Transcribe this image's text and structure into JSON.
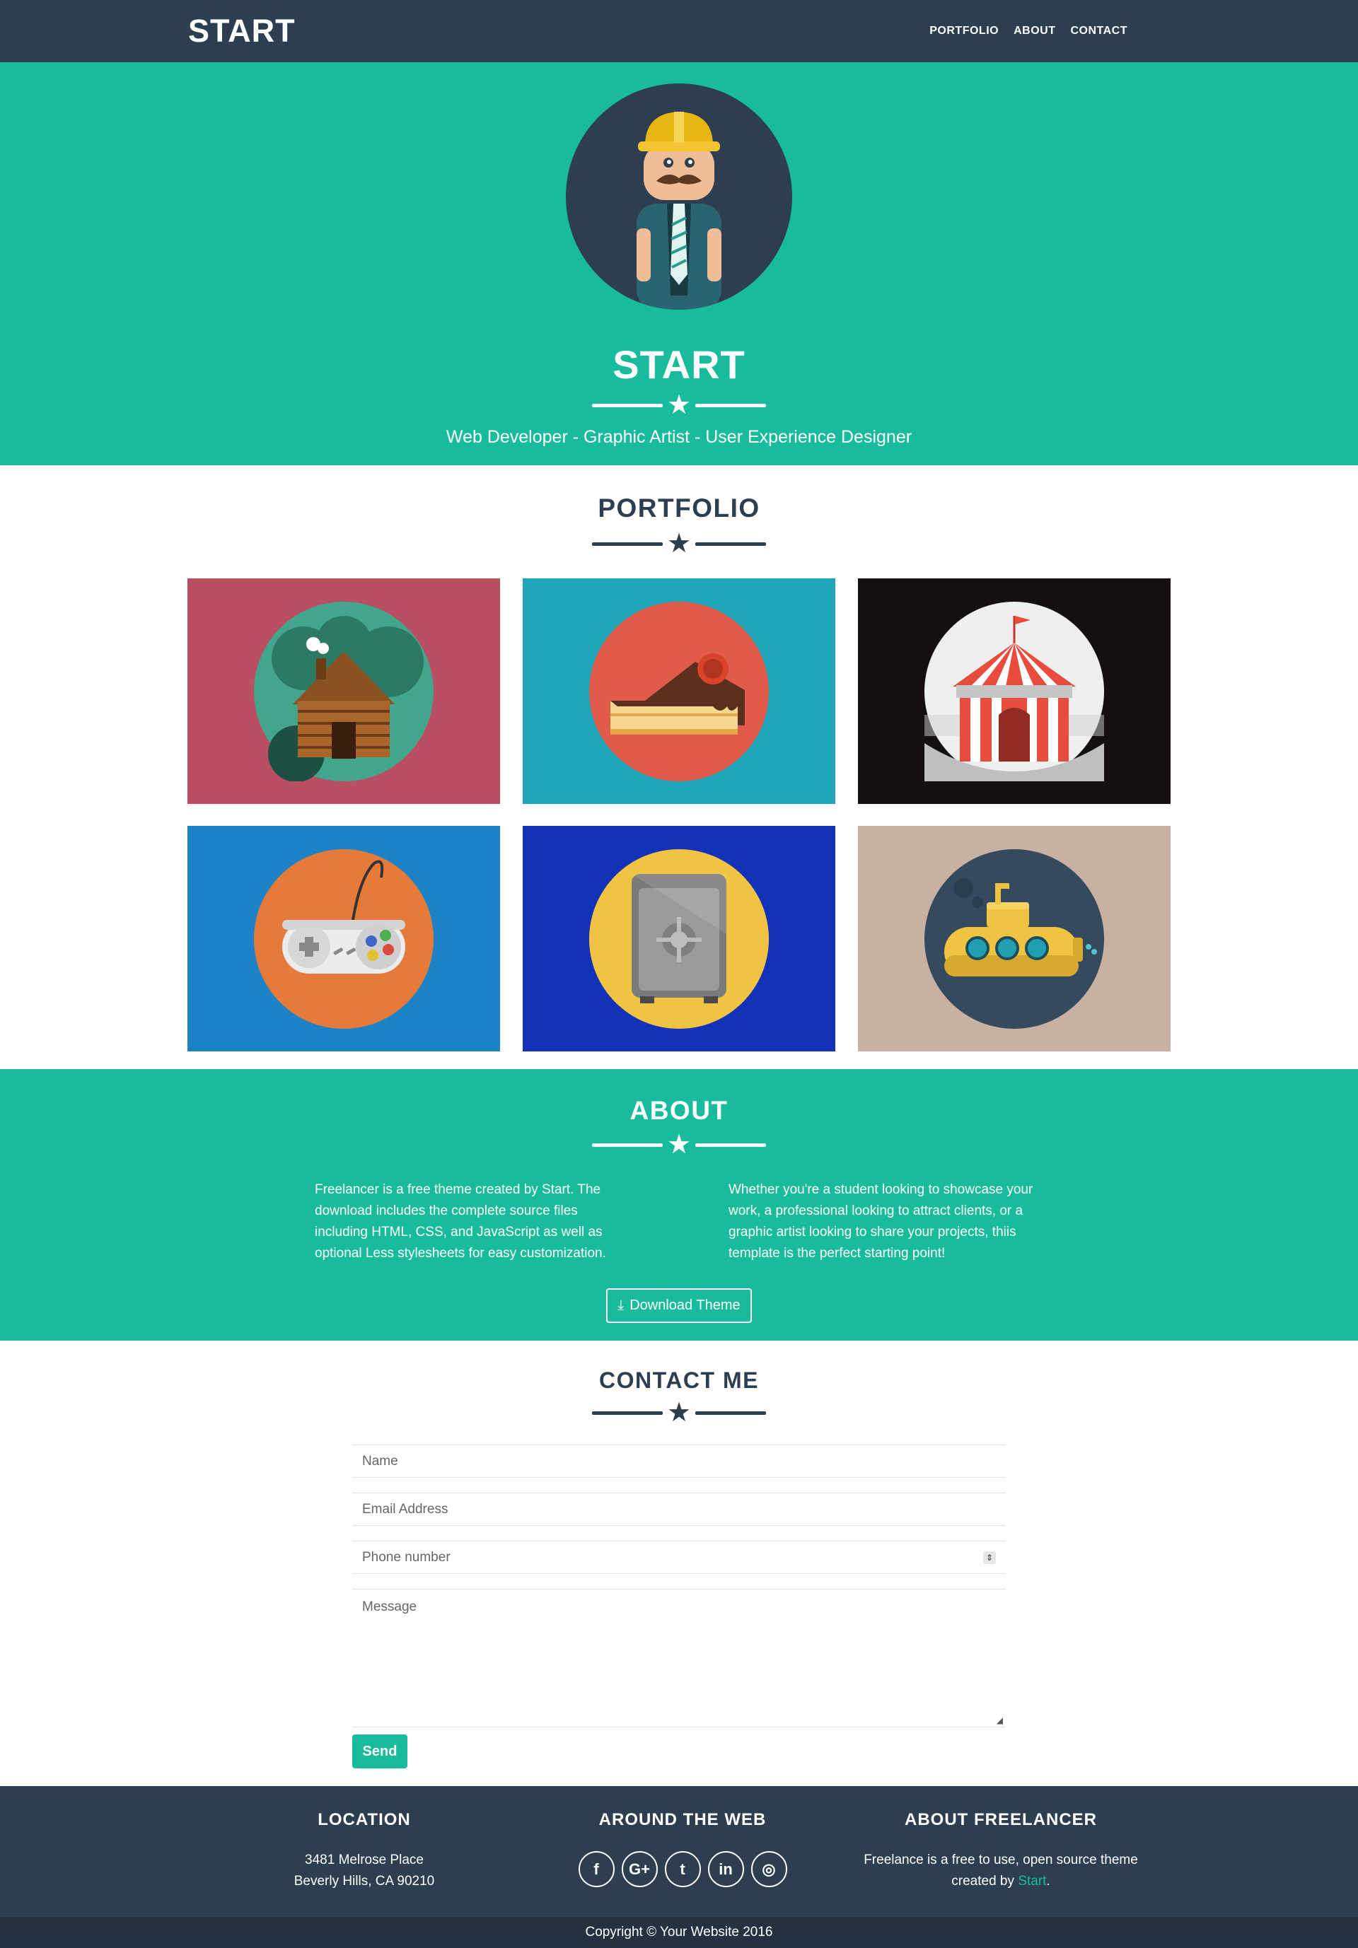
{
  "navbar": {
    "brand": "START",
    "links": [
      "PORTFOLIO",
      "ABOUT",
      "CONTACT"
    ]
  },
  "hero": {
    "title": "START",
    "subtitle": "Web Developer - Graphic Artist - User Experience Designer",
    "avatar_icon": "worker-avatar-icon"
  },
  "portfolio": {
    "title": "PORTFOLIO",
    "items": [
      {
        "icon": "cabin-icon",
        "bg": "#b94f62",
        "circle": "#43a58c"
      },
      {
        "icon": "cake-icon",
        "bg": "#20a4b8",
        "circle": "#e05b4a"
      },
      {
        "icon": "circus-tent-icon",
        "bg": "#141010",
        "circle": "#eef0f0"
      },
      {
        "icon": "game-controller-icon",
        "bg": "#1d83c6",
        "circle": "#e67a3b"
      },
      {
        "icon": "safe-icon",
        "bg": "#1233b8",
        "circle": "#f0c442"
      },
      {
        "icon": "submarine-icon",
        "bg": "#c8b0a2",
        "circle": "#344a5e"
      }
    ]
  },
  "about": {
    "title": "ABOUT",
    "col1": "Freelancer is a free theme created by Start. The download includes the complete source files including HTML, CSS, and JavaScript as well as optional Less stylesheets for easy customization.",
    "col2": "Whether you're a student looking to showcase your work, a professional looking to attract clients, or a graphic artist looking to share your projects, thiis template is the perfect starting point!",
    "download_label": "Download Theme"
  },
  "contact": {
    "title": "CONTACT ME",
    "name_placeholder": "Name",
    "email_placeholder": "Email Address",
    "phone_placeholder": "Phone number",
    "message_placeholder": "Message",
    "send_label": "Send"
  },
  "footer": {
    "location_title": "LOCATION",
    "address_line1": "3481 Melrose Place",
    "address_line2": "Beverly Hills, CA 90210",
    "web_title": "AROUND THE WEB",
    "socials": [
      {
        "icon": "facebook-icon",
        "glyph": "f"
      },
      {
        "icon": "google-plus-icon",
        "glyph": "G+"
      },
      {
        "icon": "twitter-icon",
        "glyph": "t"
      },
      {
        "icon": "linkedin-icon",
        "glyph": "in"
      },
      {
        "icon": "dribbble-icon",
        "glyph": "◎"
      }
    ],
    "about_title": "ABOUT FREELANCER",
    "about_text": "Freelance is a free to use, open source theme created by",
    "about_link": "Start",
    "about_end": "."
  },
  "copyright": "Copyright © Your Website 2016",
  "colors": {
    "primary": "#2c3e50",
    "accent": "#18bc9c"
  }
}
